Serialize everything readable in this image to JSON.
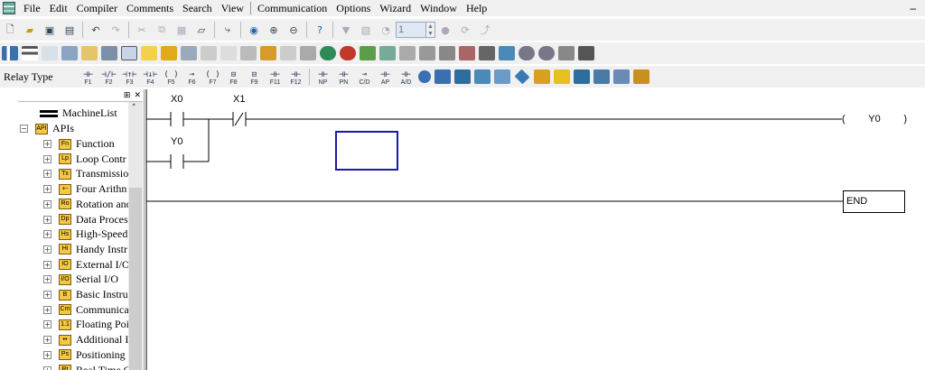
{
  "menu": [
    "File",
    "Edit",
    "Compiler",
    "Comments",
    "Search",
    "View",
    "Communication",
    "Options",
    "Wizard",
    "Window",
    "Help"
  ],
  "menu_right": "–",
  "toolbar": {
    "step_value": "1",
    "relay_type_label": "Relay Type",
    "function_keys": [
      "F1",
      "F2",
      "F3",
      "F4",
      "F5",
      "F6",
      "F7",
      "F8",
      "F9",
      "F11",
      "F12"
    ],
    "function_key_symbols": [
      "⊣⊢",
      "⊣/⊢",
      "⊣↑⊢",
      "⊣↓⊢",
      "( )",
      "⊸",
      "( )",
      "⊟",
      "⊟",
      "⊣⊢",
      "⊣⊢"
    ],
    "extra_keys": [
      "NP",
      "PN",
      "C/D",
      "AP",
      "A/D"
    ],
    "accent_colors": [
      "#3a6fb0",
      "#2e8b57",
      "#d2a21c",
      "#c0392b",
      "#6a5acd",
      "#1e90ff"
    ]
  },
  "tree": {
    "root": "MachineList",
    "category": "APIs",
    "items": [
      {
        "label": "Function",
        "icon": "Fn"
      },
      {
        "label": "Loop Contr",
        "icon": "Lp"
      },
      {
        "label": "Transmissio",
        "icon": "Tx"
      },
      {
        "label": "Four Arithn",
        "icon": "+-"
      },
      {
        "label": "Rotation anc",
        "icon": "Ro"
      },
      {
        "label": "Data Proces",
        "icon": "Dp"
      },
      {
        "label": "High-Speed",
        "icon": "Hs"
      },
      {
        "label": "Handy Instr",
        "icon": "Hi"
      },
      {
        "label": "External I/O",
        "icon": "IO"
      },
      {
        "label": "Serial I/O",
        "icon": "I/O"
      },
      {
        "label": "Basic Instru",
        "icon": "B"
      },
      {
        "label": "Communica",
        "icon": "Cm"
      },
      {
        "label": "Floating Poi",
        "icon": "1.1"
      },
      {
        "label": "Additional I",
        "icon": "••"
      },
      {
        "label": "Positioning",
        "icon": "Ps"
      },
      {
        "label": "Real Time C",
        "icon": "Rt"
      }
    ]
  },
  "ladder": {
    "contact1": "X0",
    "contact2": "X1",
    "contact3": "Y0",
    "coil_open": "(",
    "coil_label": "Y0",
    "coil_close": ")",
    "end_label": "END"
  }
}
